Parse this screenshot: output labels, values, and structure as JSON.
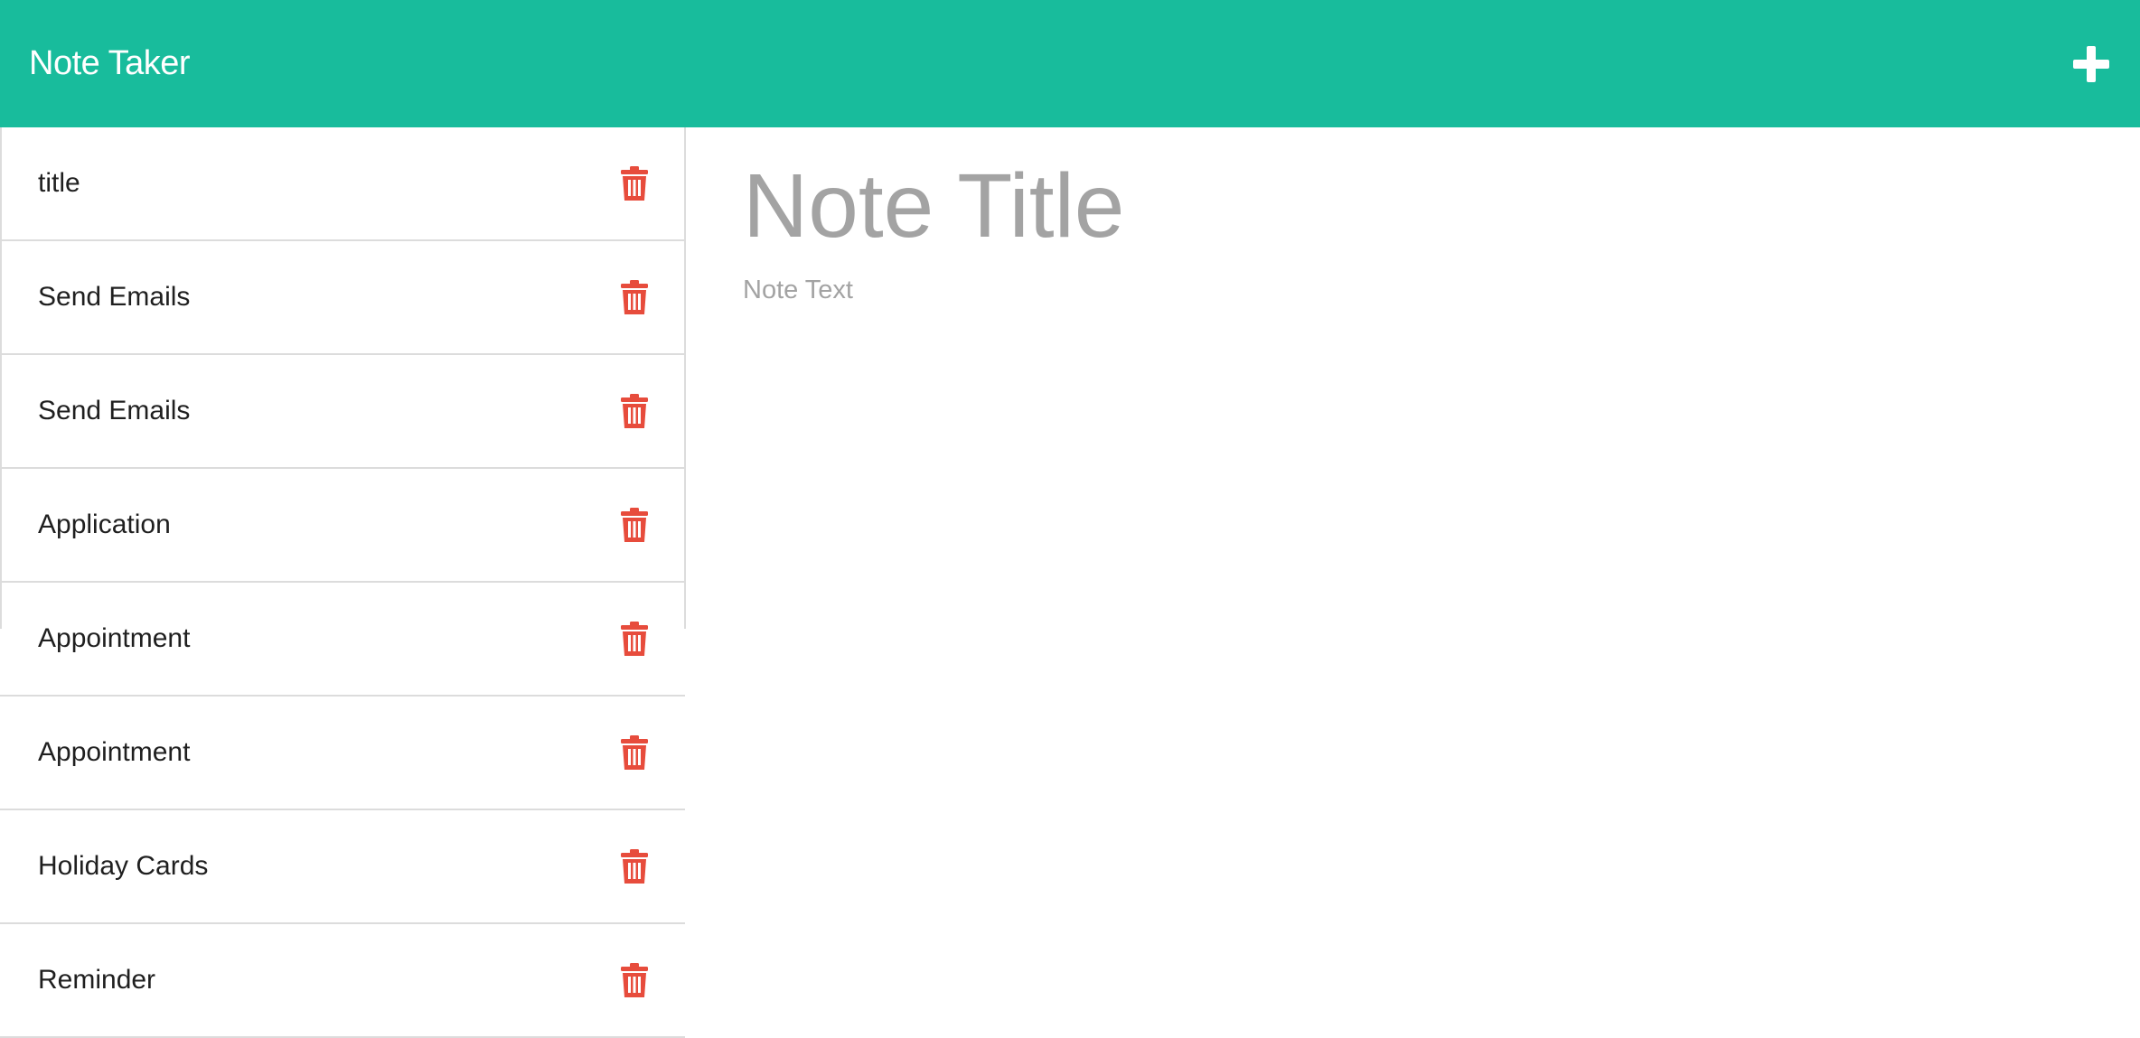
{
  "navbar": {
    "brand": "Note Taker",
    "add_icon": "plus-icon"
  },
  "notes": [
    {
      "title": "title",
      "icon": "trash-icon"
    },
    {
      "title": "Send Emails",
      "icon": "trash-icon"
    },
    {
      "title": "Send Emails",
      "icon": "trash-icon"
    },
    {
      "title": "Application",
      "icon": "trash-icon"
    },
    {
      "title": "Appointment",
      "icon": "trash-icon"
    },
    {
      "title": "Appointment",
      "icon": "trash-icon"
    },
    {
      "title": "Holiday Cards",
      "icon": "trash-icon"
    },
    {
      "title": "Reminder",
      "icon": "trash-icon"
    }
  ],
  "editor": {
    "title_placeholder": "Note Title",
    "title_value": "",
    "text_placeholder": "Note Text",
    "text_value": ""
  },
  "colors": {
    "navbar": "#18bc9c",
    "trash": "#e74c3c",
    "placeholder": "#a3a3a3",
    "divider": "#dcdcdc"
  }
}
